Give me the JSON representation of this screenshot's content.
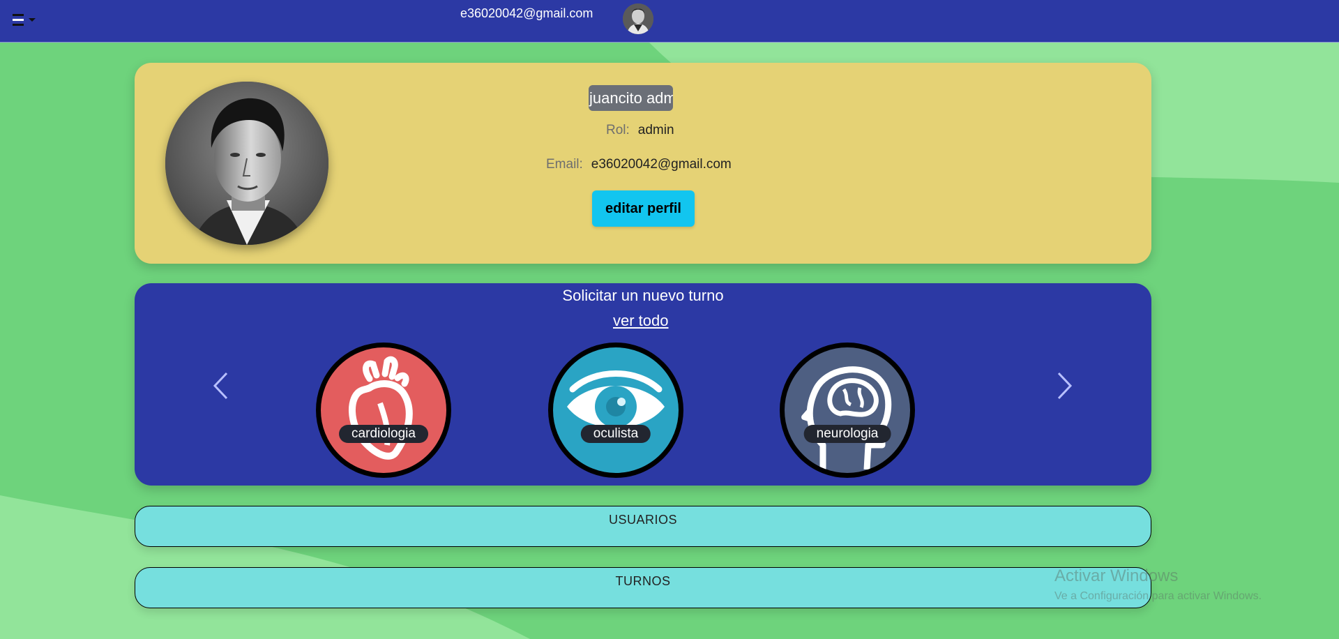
{
  "colors": {
    "navbar": "#2c39a4",
    "background": "#6ed37c",
    "profile_card": "#e5d275",
    "turno_card": "#2c39a4",
    "edit_button": "#12c5ef",
    "section_button": "#76dfde",
    "cardiologia": "#e35d5e",
    "oculista": "#2aa4c4",
    "neurologia": "#4e5f82"
  },
  "navbar": {
    "menu_icon": "hamburger-menu-icon",
    "email": "e36020042@gmail.com",
    "avatar_icon": "user-avatar"
  },
  "profile": {
    "name": "juancito adminr",
    "rol_label": "Rol:",
    "rol_value": "admin",
    "email_label": "Email:",
    "email_value": "e36020042@gmail.com",
    "edit_label": "editar perfil"
  },
  "turno": {
    "title": "Solicitar un nuevo turno",
    "ver_todo": "ver todo",
    "prev_icon": "chevron-left-icon",
    "next_icon": "chevron-right-icon",
    "specialties": [
      {
        "label": "cardiologia",
        "icon": "heart-icon"
      },
      {
        "label": "oculista",
        "icon": "eye-icon"
      },
      {
        "label": "neurologia",
        "icon": "brain-head-icon"
      }
    ]
  },
  "sections": {
    "usuarios": "USUARIOS",
    "turnos": "TURNOS"
  },
  "watermark": {
    "title": "Activar Windows",
    "subtitle": "Ve a Configuración para activar Windows."
  }
}
